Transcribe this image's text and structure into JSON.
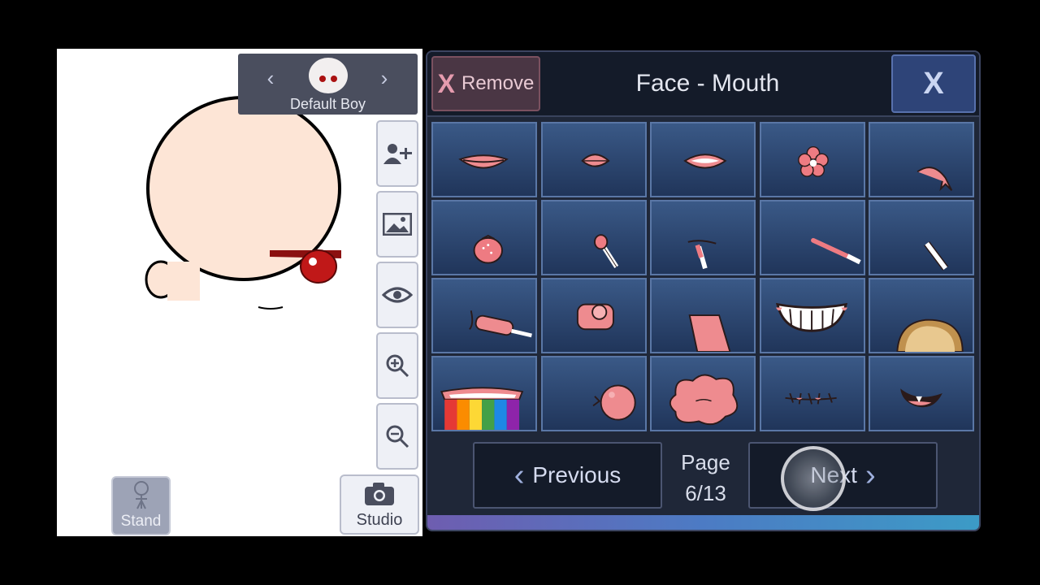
{
  "character": {
    "name": "Default Boy"
  },
  "side_toolbar": [
    {
      "name": "add-character-button",
      "icon": "add-person-icon"
    },
    {
      "name": "background-button",
      "icon": "image-icon"
    },
    {
      "name": "visibility-button",
      "icon": "eye-icon"
    },
    {
      "name": "zoom-in-button",
      "icon": "zoom-in-icon"
    },
    {
      "name": "zoom-out-button",
      "icon": "zoom-out-icon"
    }
  ],
  "stand_button": {
    "label": "Stand"
  },
  "studio_button": {
    "label": "Studio"
  },
  "panel": {
    "remove_label": "Remove",
    "remove_icon": "X",
    "title": "Face - Mouth",
    "close_label": "X"
  },
  "items": [
    "lips-smile",
    "lips-small",
    "lips-open",
    "flower",
    "tongue-out",
    "strawberry",
    "lollipop",
    "straw",
    "pocky-stick",
    "cigarette",
    "popsicle",
    "bubblegum-pink",
    "tongue-long",
    "grin-teeth",
    "toast",
    "rainbow-vomit",
    "bubble",
    "blob",
    "stitched-mouth",
    "fang-smile"
  ],
  "pagination": {
    "previous_label": "Previous",
    "next_label": "Next",
    "page_label": "Page",
    "page_value": "6/13"
  },
  "colors": {
    "accent": "#ee8b8f",
    "panel": "#1f2738",
    "tile": "#2e4a77"
  }
}
